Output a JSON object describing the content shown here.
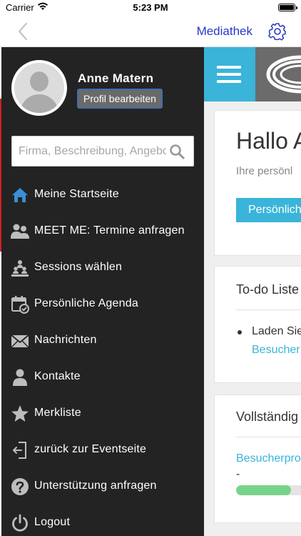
{
  "status_bar": {
    "carrier": "Carrier",
    "time": "5:23 PM"
  },
  "nav": {
    "title": "Mediathek",
    "back_icon": "chevron-left-icon",
    "settings_icon": "gear-icon"
  },
  "drawer": {
    "user_name": "Anne Matern",
    "edit_profile_label": "Profil bearbeiten",
    "search_placeholder": "Firma, Beschreibung, Angebot",
    "menu": [
      {
        "label": "Meine Startseite",
        "icon": "home-icon"
      },
      {
        "label": "MEET ME: Termine anfragen",
        "icon": "people-icon"
      },
      {
        "label": "Sessions wählen",
        "icon": "audience-icon"
      },
      {
        "label": "Persönliche Agenda",
        "icon": "calendar-check-icon"
      },
      {
        "label": "Nachrichten",
        "icon": "envelope-icon"
      },
      {
        "label": "Kontakte",
        "icon": "person-icon"
      },
      {
        "label": "Merkliste",
        "icon": "star-icon"
      },
      {
        "label": "zurück zur Eventseite",
        "icon": "exit-door-icon"
      },
      {
        "label": "Unterstützung anfragen",
        "icon": "question-icon"
      },
      {
        "label": "Logout",
        "icon": "power-icon"
      }
    ]
  },
  "main": {
    "greeting": "Hallo A",
    "greeting_sub": "Ihre persönl",
    "greeting_button": "Persönlich",
    "todo_title": "To-do Liste",
    "todo_item": "Laden Sie",
    "todo_link": "Besucher",
    "complete_title": "Vollständig",
    "complete_link": "Besucherpro",
    "complete_dash": "-",
    "progress_fraction": 0.7
  },
  "colors": {
    "drawer_bg": "#232323",
    "accent_blue": "#3ab4d9",
    "home_icon": "#3a8fd6",
    "nav_title": "#2838c8",
    "progress_green": "#78d38a"
  }
}
